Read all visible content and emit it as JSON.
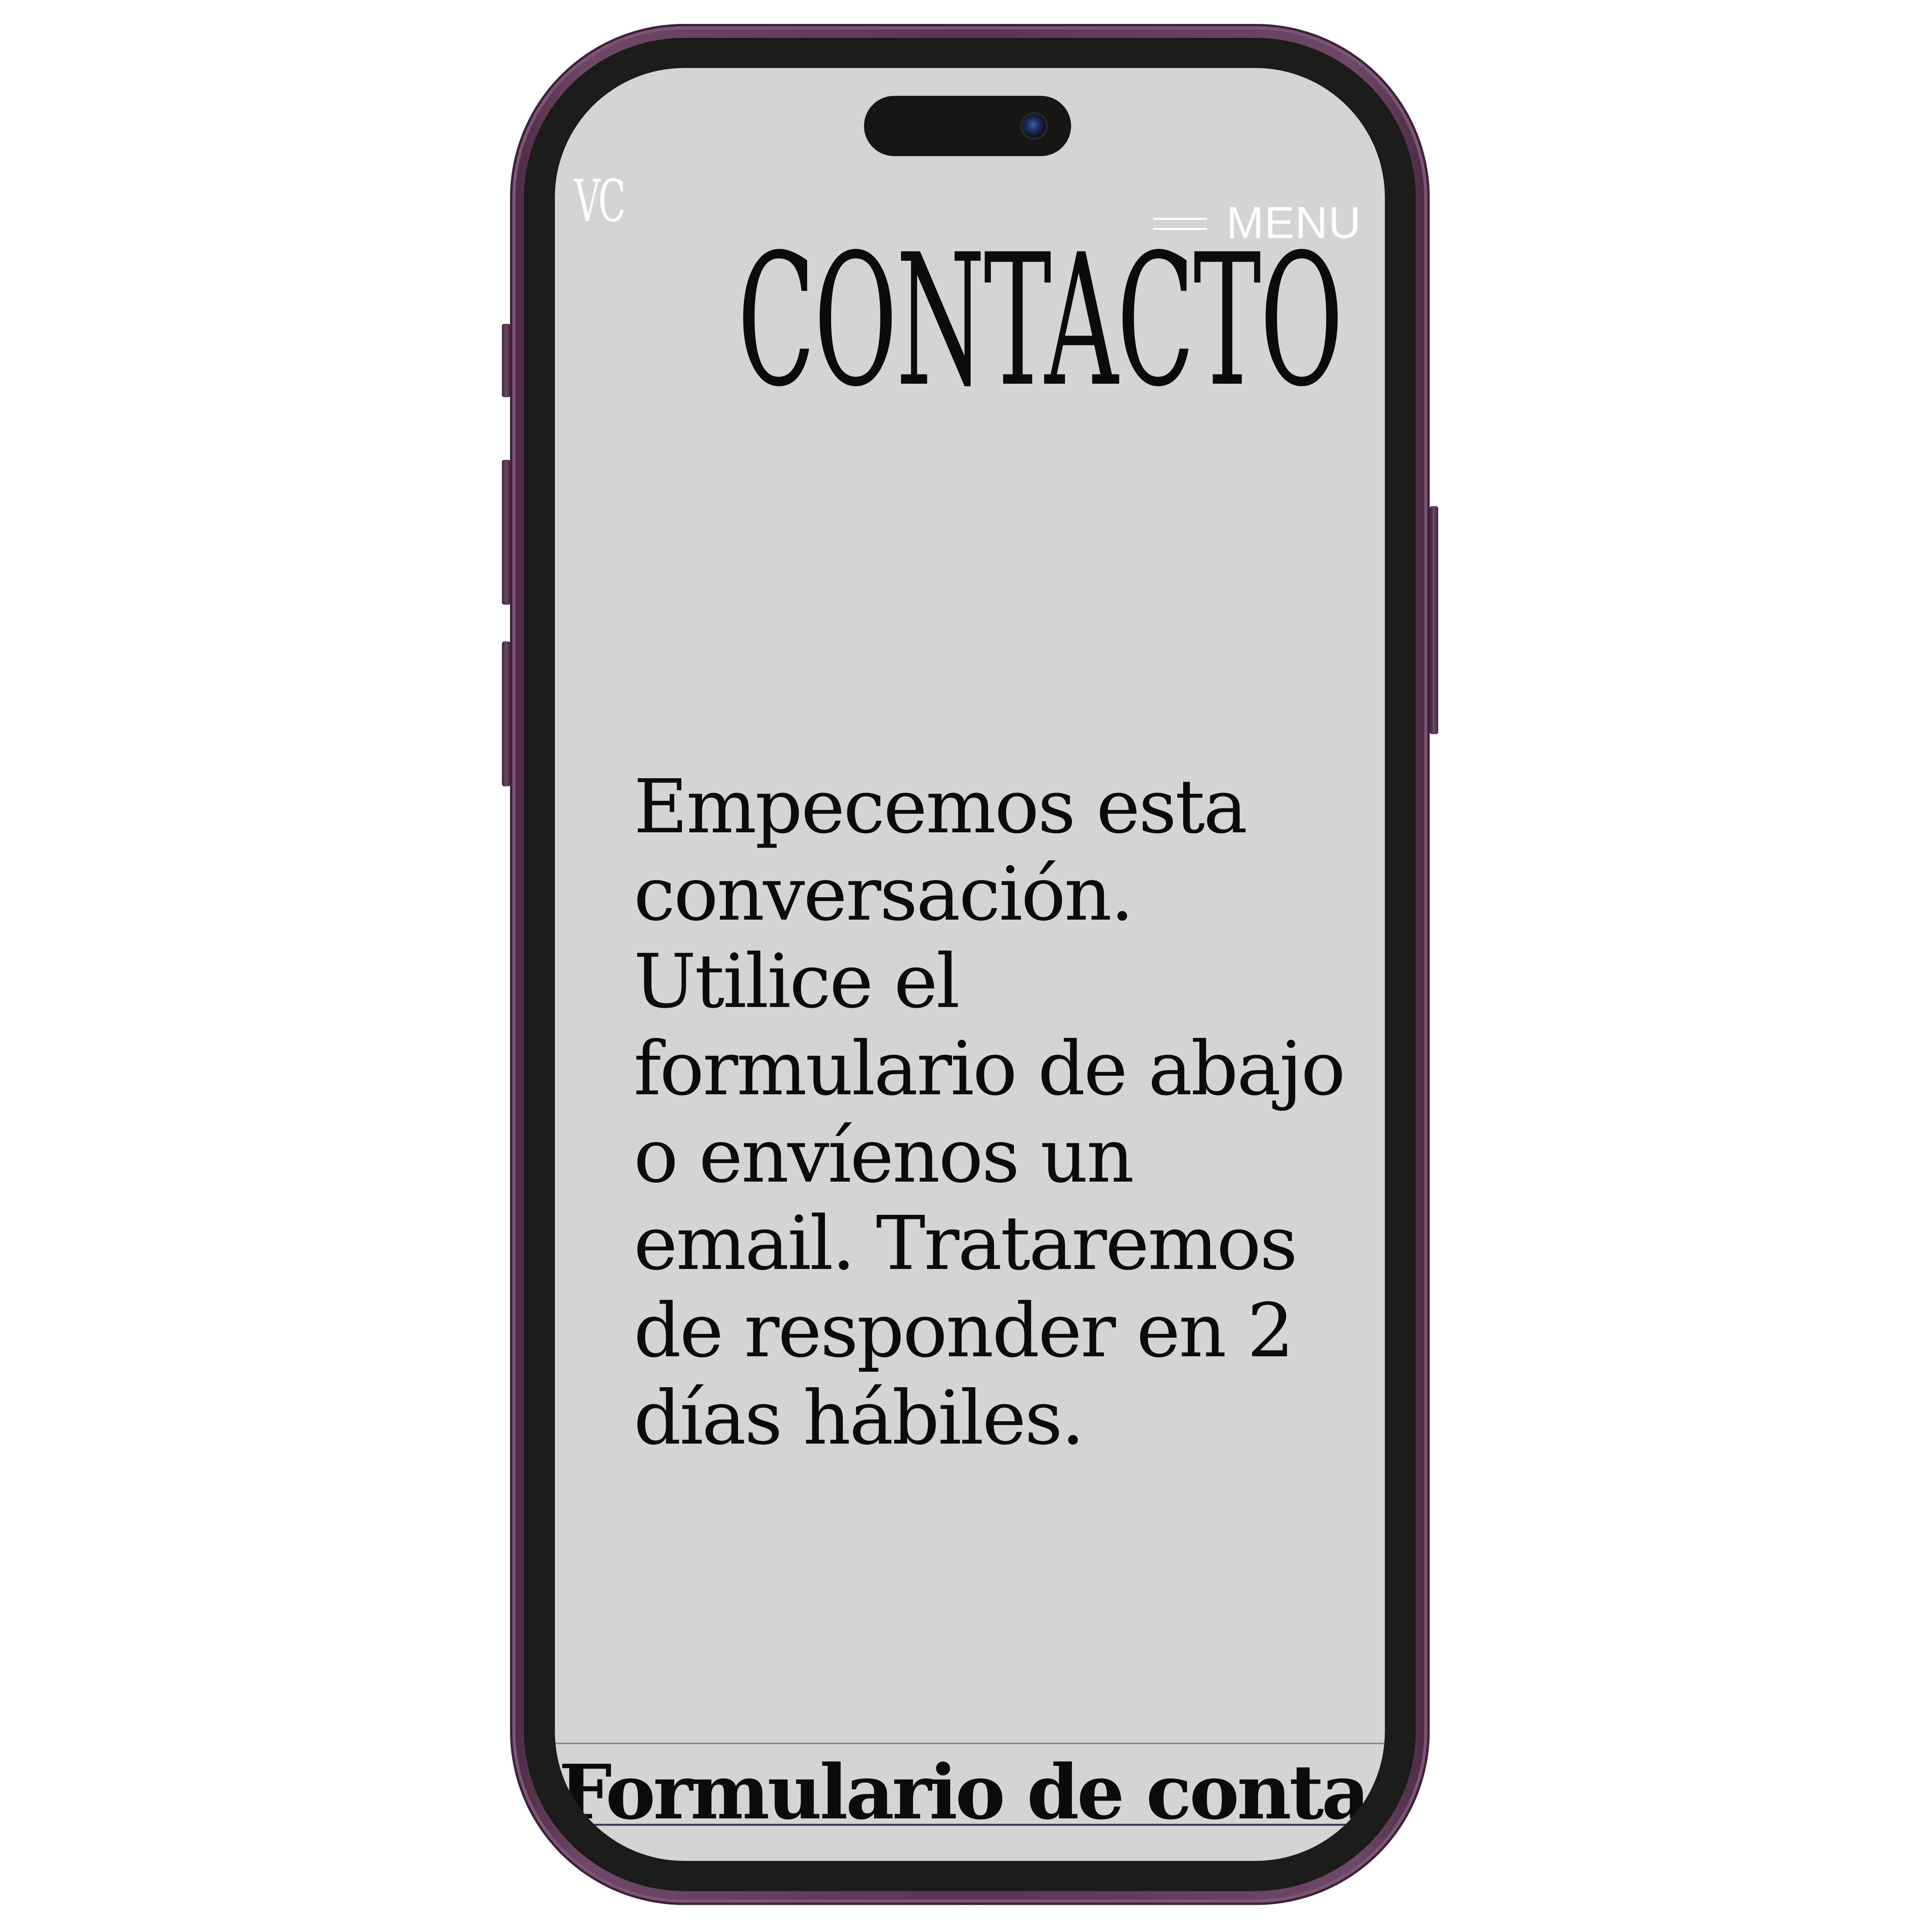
{
  "header": {
    "logo_text": "VC",
    "menu_label": "MENU",
    "menu_icon": "hamburger-icon"
  },
  "main": {
    "title": "CONTACTO",
    "intro": "Empecemos esta conversación. Utilice el formulario de abajo o envíenos un email. Trataremos de responder en 2 días hábiles.",
    "form_link": "Formulario de contacto"
  },
  "colors": {
    "screen_background": "#d4d4d4",
    "text": "#0b0b0b",
    "header_text": "#ffffff",
    "phone_frame": "#5a3453",
    "bezel": "#1b1b18"
  }
}
